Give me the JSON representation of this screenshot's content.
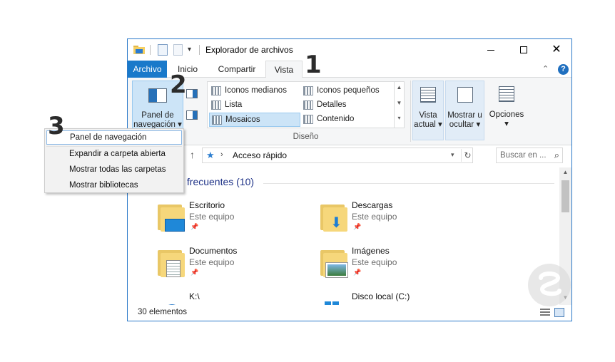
{
  "window": {
    "title": "Explorador de archivos"
  },
  "tabs": [
    {
      "label": "Archivo"
    },
    {
      "label": "Inicio"
    },
    {
      "label": "Compartir"
    },
    {
      "label": "Vista"
    }
  ],
  "ribbon": {
    "panel_button": {
      "line1": "Panel de",
      "line2": "navegación ▾"
    },
    "layout_options": [
      {
        "label": "Iconos medianos"
      },
      {
        "label": "Iconos pequeños"
      },
      {
        "label": "Lista"
      },
      {
        "label": "Detalles"
      },
      {
        "label": "Mosaicos",
        "selected": true
      },
      {
        "label": "Contenido"
      }
    ],
    "group_label": "Diseño",
    "vista_actual": {
      "line1": "Vista",
      "line2": "actual ▾"
    },
    "mostrar_ocultar": {
      "line1": "Mostrar u",
      "line2": "ocultar ▾"
    },
    "opciones": {
      "line1": "Opciones",
      "line2": "▾"
    }
  },
  "address": {
    "path": "Acceso rápido",
    "search_placeholder": "Buscar en ..."
  },
  "content": {
    "section_title": "s frecuentes (10)",
    "items": [
      {
        "name": "Escritorio",
        "location": "Este equipo",
        "icon": "desktop-folder-icon"
      },
      {
        "name": "Descargas",
        "location": "Este equipo",
        "icon": "downloads-folder-icon"
      },
      {
        "name": "Documentos",
        "location": "Este equipo",
        "icon": "documents-folder-icon"
      },
      {
        "name": "Imágenes",
        "location": "Este equipo",
        "icon": "pictures-folder-icon"
      },
      {
        "name": "K:\\",
        "location": "",
        "icon": "drive-icon"
      },
      {
        "name": "Disco local (C:)",
        "location": "",
        "icon": "windows-drive-icon"
      }
    ]
  },
  "status": {
    "count": "30 elementos"
  },
  "menu": {
    "items": [
      {
        "label": "Panel de navegación",
        "checked": true
      },
      {
        "label": "Expandir a carpeta abierta"
      },
      {
        "label": "Mostrar todas las carpetas"
      },
      {
        "label": "Mostrar bibliotecas"
      }
    ]
  },
  "annotations": {
    "step1": "1",
    "step2": "2",
    "step3": "3"
  },
  "colors": {
    "accent": "#1979ca",
    "selection": "#cce4f7",
    "section_title": "#1e3287"
  }
}
